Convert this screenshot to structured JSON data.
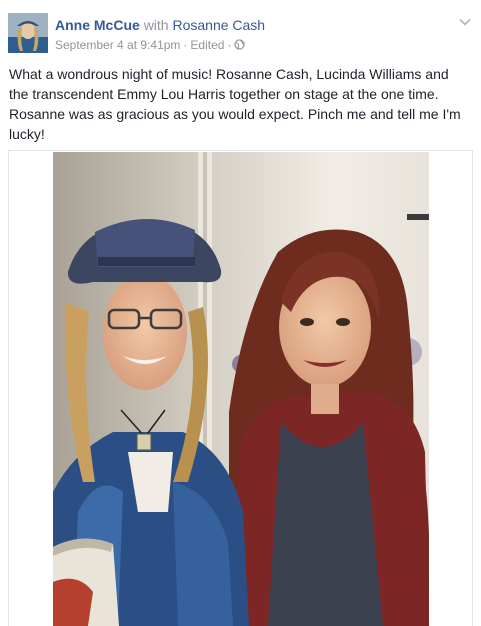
{
  "post": {
    "author": "Anne McCue",
    "with_text": "with",
    "tagged_person": "Rosanne Cash",
    "timestamp": "September 4 at 9:41pm",
    "edited_label": "Edited",
    "separator": "·",
    "privacy_icon": "globe-icon",
    "menu_icon": "chevron-down-icon",
    "text": "What a wondrous night of music! Rosanne Cash, Lucinda Williams and the transcendent Emmy Lou Harris together on stage at the one time. Rosanne was as gracious as you would expect. Pinch me and tell me I'm lucky!"
  },
  "colors": {
    "link": "#365899",
    "meta": "#90949c",
    "text": "#1d2129"
  }
}
